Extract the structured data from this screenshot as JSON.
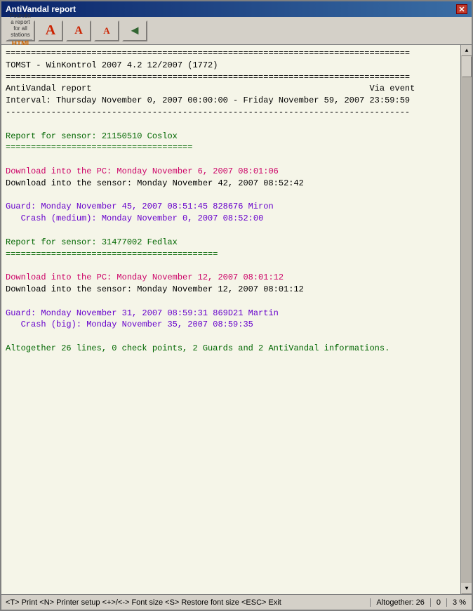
{
  "window": {
    "title": "AntiVandal report"
  },
  "toolbar": {
    "buttons": [
      {
        "id": "print",
        "label": "Print a report for all\nstations",
        "display": "PRINT"
      },
      {
        "id": "html",
        "label": "HTML"
      },
      {
        "id": "font-large",
        "label": "A"
      },
      {
        "id": "font-medium",
        "label": "A"
      },
      {
        "id": "font-small",
        "label": "A"
      },
      {
        "id": "back",
        "label": "◄"
      }
    ]
  },
  "report": {
    "separator_long": "================================================================================",
    "separator_dashes": "--------------------------------------------------------------------------------",
    "line1": "TOMST - WinKontrol 2007 4.2 12/2007 (1772)",
    "line2": "AntiVandal report                                                       Via event",
    "line3": "Interval: Thursday November 0, 2007 00:00:00 - Friday November 59, 2007 23:59:59",
    "sensor1_separator": "=====================================",
    "sensor1_label": "Report for sensor: 21150510 Coslox",
    "sensor1_dl1": "Download into the PC: Monday November 6, 2007 08:01:06",
    "sensor1_dl2": "Download into the sensor: Monday November 42, 2007 08:52:42",
    "sensor1_guard": "Guard: Monday November 45, 2007 08:51:45 828676 Miron",
    "sensor1_crash": "   Crash (medium): Monday November 0, 2007 08:52:00",
    "sensor2_separator": "==========================================",
    "sensor2_label": "Report for sensor: 31477002 Fedlax",
    "sensor2_dl1": "Download into the PC: Monday November 12, 2007 08:01:12",
    "sensor2_dl2": "Download into the sensor: Monday November 12, 2007 08:01:12",
    "sensor2_guard": "Guard: Monday November 31, 2007 08:59:31 869D21 Martin",
    "sensor2_crash": "   Crash (big): Monday November 35, 2007 08:59:35",
    "summary": "Altogether 26 lines, 0 check points, 2 Guards and 2 AntiVandal informations."
  },
  "status": {
    "shortcuts": "<T> Print <N> Printer setup <+>/<-> Font size <S> Restore font size <ESC> Exit",
    "altogether": "Altogether: 26",
    "count": "0",
    "percent": "3 %"
  }
}
